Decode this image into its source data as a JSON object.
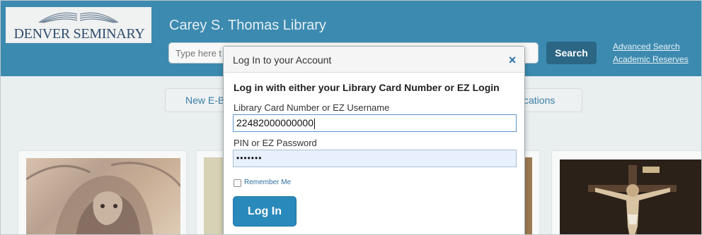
{
  "header": {
    "logo_text": "DENVER SEMINARY",
    "site_title": "Carey S. Thomas Library",
    "search": {
      "placeholder": "Type here t",
      "button_label": "Search"
    },
    "links": [
      "Advanced Search",
      "Academic Reserves"
    ]
  },
  "nav": {
    "left_partial": "New E-B",
    "right_partial": "plications"
  },
  "modal": {
    "title": "Log In to your Account",
    "close_label": "×",
    "heading": "Log in with either your Library Card Number or EZ Login",
    "username_label": "Library Card Number or EZ Username",
    "username_value": "22482000000000",
    "password_label": "PIN or EZ Password",
    "password_value": "•••••••",
    "remember_label": "Remember Me",
    "login_button": "Log In"
  },
  "colors": {
    "header_bg": "#3c8ab0",
    "search_button": "#2b6685",
    "login_button": "#2989bb",
    "link": "#2f74a6"
  }
}
